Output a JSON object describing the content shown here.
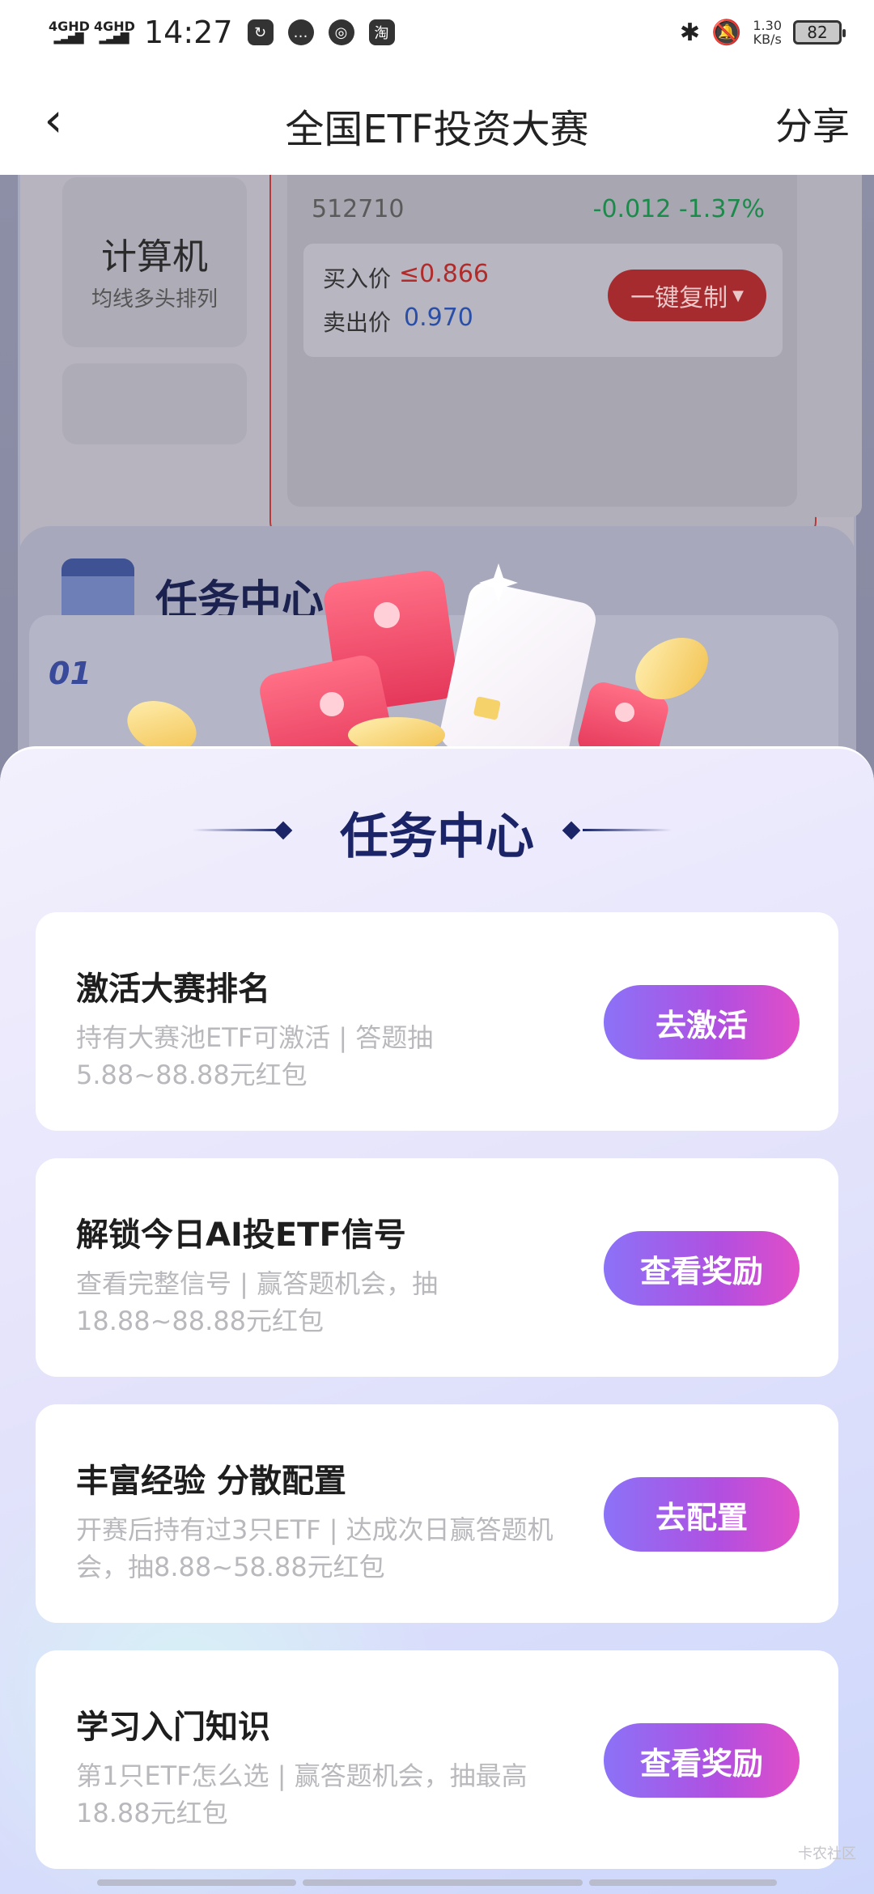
{
  "status_bar": {
    "network1": "4GHD",
    "network2": "4GHD",
    "time": "14:27",
    "app_icon_3": "淘",
    "speed_value": "1.30",
    "speed_unit": "KB/s",
    "battery": "82",
    "icons": [
      "sync-icon",
      "message-icon",
      "compass-icon",
      "taobao-icon",
      "bluetooth-icon",
      "mute-icon"
    ]
  },
  "nav": {
    "title": "全国ETF投资大赛",
    "share": "分享",
    "back_glyph": "‹"
  },
  "background": {
    "sector_name": "计算机",
    "sector_sub": "均线多头排列",
    "stock_code": "512710",
    "stock_change": "-0.012 -1.37%",
    "buy_label": "买入价",
    "buy_value": "≤0.866",
    "sell_label": "卖出价",
    "sell_value": "0.970",
    "copy_button": "一键复制",
    "task_title": "任务中心",
    "task_num": "01"
  },
  "sheet": {
    "title": "任务中心",
    "tasks": [
      {
        "title": "激活大赛排名",
        "desc": "持有大赛池ETF可激活 | 答题抽5.88~88.88元红包",
        "button": "去激活"
      },
      {
        "title": "解锁今日AI投ETF信号",
        "desc": "查看完整信号 | 赢答题机会，抽18.88~88.88元红包",
        "button": "查看奖励"
      },
      {
        "title": "丰富经验 分散配置",
        "desc": "开赛后持有过3只ETF | 达成次日赢答题机会，抽8.88~58.88元红包",
        "button": "去配置"
      },
      {
        "title": "学习入门知识",
        "desc": "第1只ETF怎么选 | 赢答题机会，抽最高18.88元红包",
        "button": "查看奖励"
      }
    ]
  },
  "watermark": "卡农社区",
  "colors": {
    "accent_gradient_start": "#8b72f7",
    "accent_gradient_end": "#e24ec7",
    "title_navy": "#1a2466",
    "price_red": "#b22b2b",
    "price_blue": "#2a4fa8",
    "change_green": "#1b8a4b"
  }
}
